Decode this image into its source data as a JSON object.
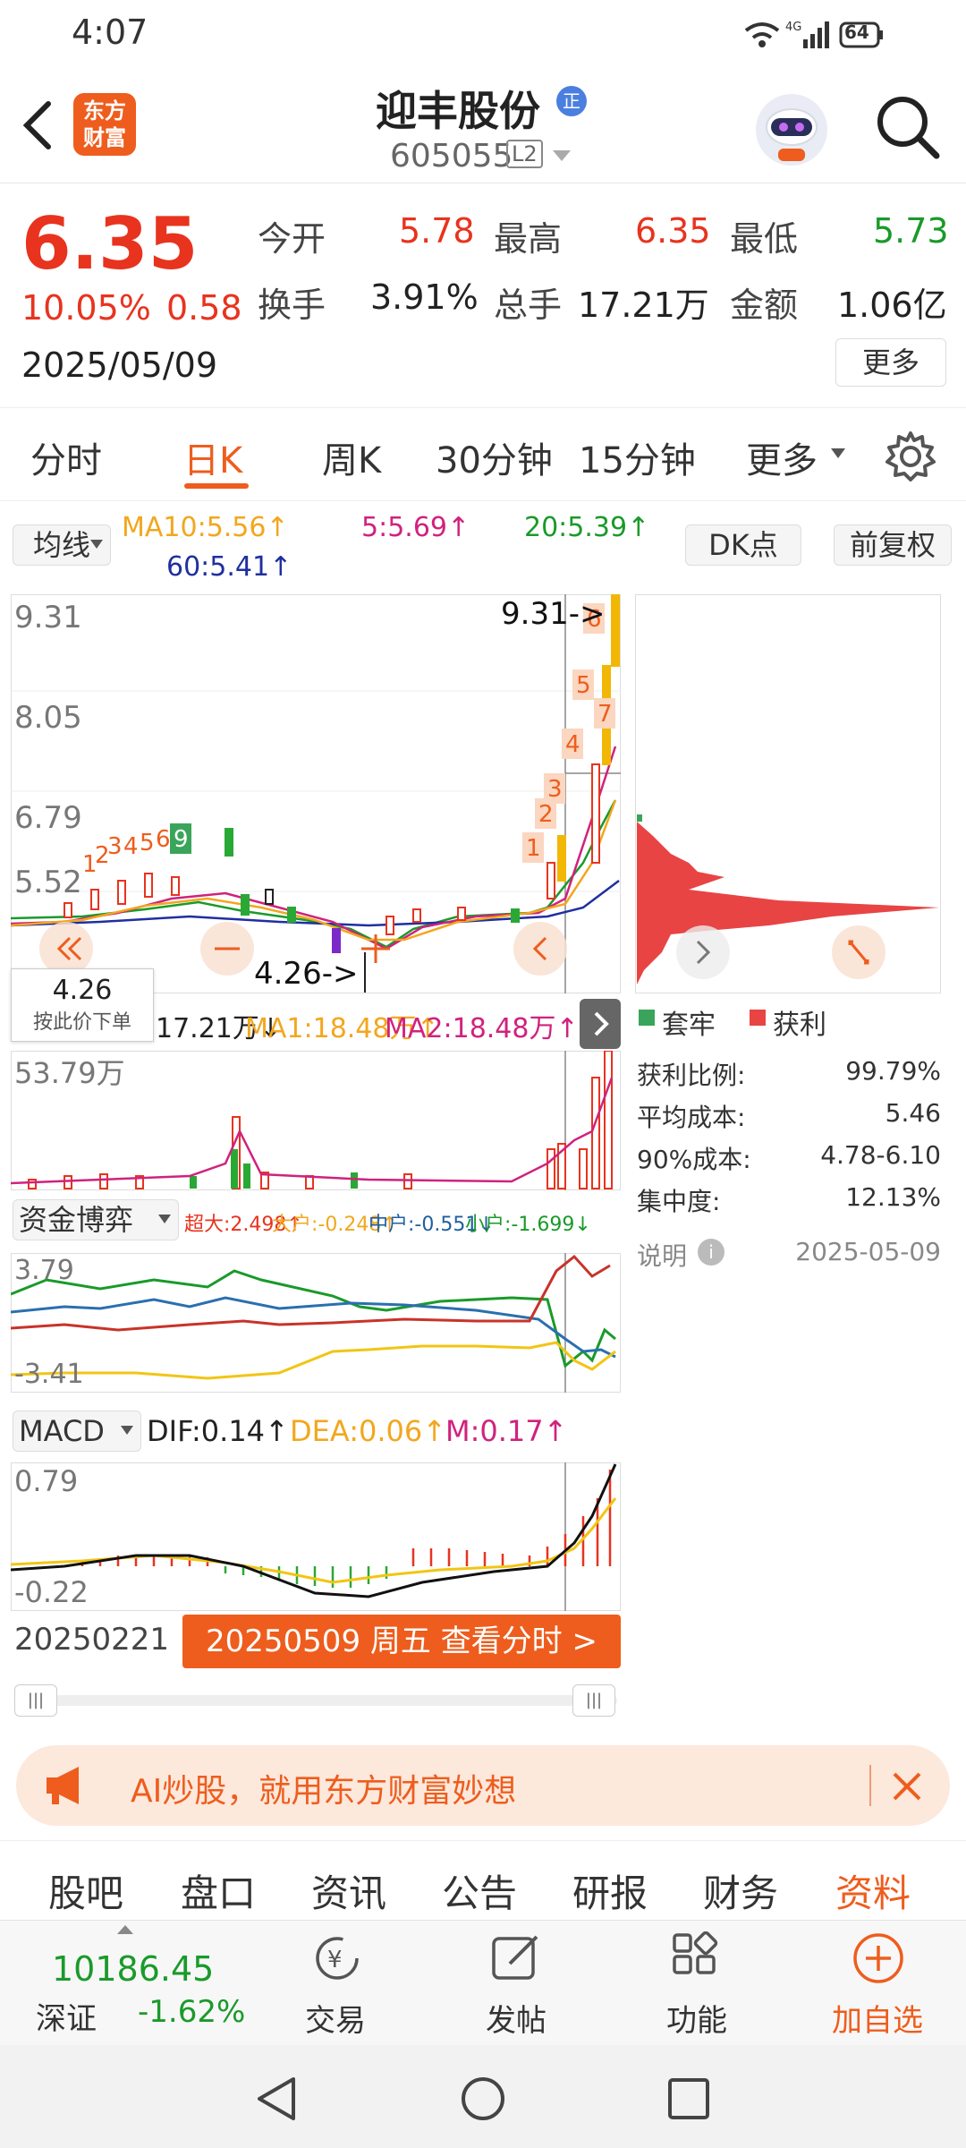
{
  "status": {
    "time": "4:07",
    "battery": "64"
  },
  "header": {
    "logo_text": "东方财富",
    "stock_name": "迎丰股份",
    "badge": "正",
    "stock_code": "605055",
    "level": "L2"
  },
  "quote": {
    "price": "6.35",
    "change_pct": "10.05%",
    "change": "0.58",
    "date": "2025/05/09",
    "open_label": "今开",
    "open": "5.78",
    "high_label": "最高",
    "high": "6.35",
    "low_label": "最低",
    "low": "5.73",
    "turnover_label": "换手",
    "turnover": "3.91%",
    "volume_label": "总手",
    "volume": "17.21万",
    "amount_label": "金额",
    "amount": "1.06亿",
    "more_button": "更多"
  },
  "tabs": {
    "t1": "分时",
    "t2": "日K",
    "t3": "周K",
    "t4": "30分钟",
    "t5": "15分钟",
    "t6": "更多"
  },
  "chart": {
    "ma_label": "均线",
    "ma10": "MA10:5.56↑",
    "ma5": "5:5.69↑",
    "ma20": "20:5.39↑",
    "ma60": "60:5.41↑",
    "dk_label": "DK点",
    "fq_label": "前复权",
    "y1": "9.31",
    "y2": "8.05",
    "y3": "6.79",
    "y4": "5.52",
    "high_marker": "9.31->",
    "low_marker": "4.26->",
    "price_box": "4.26",
    "order_hint": "按此价下单",
    "vol_line": "17.21万↓",
    "ma1": "MA1:18.48万↑",
    "ma2": "MA2:18.48万↑",
    "vol_max": "53.79万",
    "fund_label": "资金博弈",
    "super": "超大:2.498↑",
    "big": "大户:-0.248↑",
    "mid": "中户:-0.551↓",
    "small": "小户:-1.699↓",
    "fund_top": "3.79",
    "fund_bottom": "-3.41",
    "macd_label": "MACD",
    "dif": "DIF:0.14↑",
    "dea": "DEA:0.06↑",
    "m": "M:0.17↑",
    "macd_top": "0.79",
    "macd_bottom": "-0.22",
    "start_date": "20250221",
    "selected_date": "20250509 周五 查看分时 >"
  },
  "chip": {
    "legend_trap": "套牢",
    "legend_profit": "获利",
    "profit_ratio_label": "获利比例:",
    "profit_ratio": "99.79%",
    "avg_cost_label": "平均成本:",
    "avg_cost": "5.46",
    "cost90_label": "90%成本:",
    "cost90": "4.78-6.10",
    "concentration_label": "集中度:",
    "concentration": "12.13%",
    "note_label": "说明",
    "note_date": "2025-05-09"
  },
  "banner": {
    "text": "AI炒股，就用东方财富妙想"
  },
  "subtabs": {
    "s1": "股吧",
    "s2": "盘口",
    "s3": "资讯",
    "s4": "公告",
    "s5": "研报",
    "s6": "财务",
    "s7": "资料"
  },
  "bottom": {
    "index_value": "10186.45",
    "index_name": "深证",
    "index_change": "-1.62%",
    "trade": "交易",
    "post": "发帖",
    "func": "功能",
    "add": "加自选"
  },
  "colors": {
    "accent": "#ee5d1d",
    "up": "#e8331e",
    "down": "#1a9a2a"
  }
}
